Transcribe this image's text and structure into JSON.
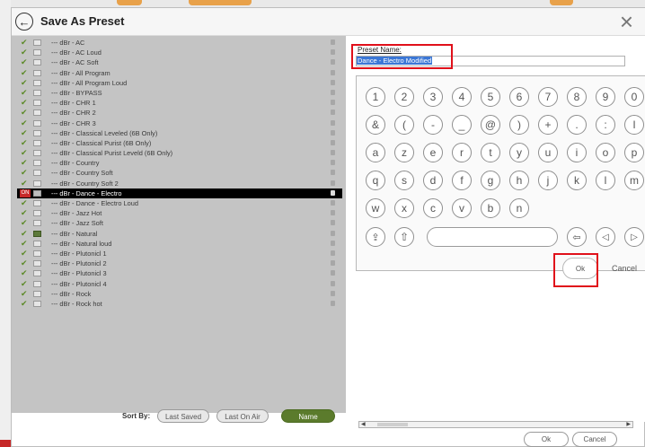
{
  "dialog": {
    "title": "Save As Preset",
    "back_icon": "arrow-left-icon",
    "close_icon": "close-icon",
    "close_glyph": "×"
  },
  "presets": [
    {
      "label": "--- dBr - AC"
    },
    {
      "label": "--- dBr - AC Loud"
    },
    {
      "label": "--- dBr - AC Soft"
    },
    {
      "label": "--- dBr - All Program"
    },
    {
      "label": "--- dBr - All Program Loud"
    },
    {
      "label": "--- dBr - BYPASS"
    },
    {
      "label": "--- dBr - CHR 1"
    },
    {
      "label": "--- dBr - CHR 2"
    },
    {
      "label": "--- dBr - CHR 3"
    },
    {
      "label": "--- dBr - Classical Leveled (6B Only)"
    },
    {
      "label": "--- dBr - Classical Purist (6B Only)"
    },
    {
      "label": "--- dBr - Classical Purist Leveld (6B Only)"
    },
    {
      "label": "--- dBr - Country"
    },
    {
      "label": "--- dBr - Country Soft"
    },
    {
      "label": "--- dBr - Country Soft 2"
    },
    {
      "label": "--- dBr - Dance - Electro",
      "selected": true
    },
    {
      "label": "--- dBr - Dance - Electro Loud"
    },
    {
      "label": "--- dBr - Jazz Hot"
    },
    {
      "label": "--- dBr - Jazz Soft"
    },
    {
      "label": "--- dBr - Natural",
      "dark_icon": true
    },
    {
      "label": "--- dBr - Natural loud"
    },
    {
      "label": "--- dBr - Plutonicl 1"
    },
    {
      "label": "--- dBr - Plutonicl 2"
    },
    {
      "label": "--- dBr - Plutonicl 3"
    },
    {
      "label": "--- dBr - Plutonicl 4"
    },
    {
      "label": "--- dBr - Rock"
    },
    {
      "label": "--- dBr - Rock hot"
    }
  ],
  "sort": {
    "label": "Sort By:",
    "options": [
      "Last Saved",
      "Last On Air",
      "Name"
    ],
    "active": "Name"
  },
  "preset_name": {
    "label": "Preset Name:",
    "value": "Dance - Electro Modified"
  },
  "keyboard": {
    "row1": [
      "1",
      "2",
      "3",
      "4",
      "5",
      "6",
      "7",
      "8",
      "9",
      "0"
    ],
    "row2": [
      "&",
      "(",
      "-",
      "_",
      "@",
      ")",
      "+",
      ".",
      ":",
      "I"
    ],
    "row3": [
      "a",
      "z",
      "e",
      "r",
      "t",
      "y",
      "u",
      "i",
      "o",
      "p"
    ],
    "row4": [
      "q",
      "s",
      "d",
      "f",
      "g",
      "h",
      "j",
      "k",
      "l",
      "m"
    ],
    "row5": [
      "w",
      "x",
      "c",
      "v",
      "b",
      "n"
    ],
    "ok_label": "Ok",
    "cancel_label": "Cancel"
  },
  "footer": {
    "ok_label": "Ok",
    "cancel_label": "Cancel"
  },
  "colors": {
    "selection_row": "#000000",
    "sort_active": "#5b7b2c",
    "highlight_box": "#e0101a",
    "text_selection": "#3b77d6"
  }
}
